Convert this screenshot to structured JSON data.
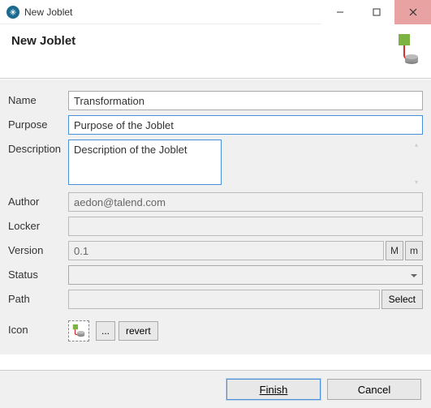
{
  "window": {
    "title": "New Joblet",
    "minimize_tip": "Minimize",
    "maximize_tip": "Maximize",
    "close_tip": "Close"
  },
  "header": {
    "title": "New Joblet"
  },
  "form": {
    "labels": {
      "name": "Name",
      "purpose": "Purpose",
      "description": "Description",
      "author": "Author",
      "locker": "Locker",
      "version": "Version",
      "status": "Status",
      "path": "Path",
      "icon": "Icon"
    },
    "name_value": "Transformation",
    "purpose_value": "Purpose of the Joblet",
    "description_value": "Description of the Joblet",
    "author_value": "aedon@talend.com",
    "locker_value": "",
    "version_value": "0.1",
    "version_major_btn": "M",
    "version_minor_btn": "m",
    "status_value": "",
    "path_value": "",
    "path_select_btn": "Select",
    "icon_browse_btn": "...",
    "icon_revert_btn": "revert"
  },
  "buttons": {
    "finish": "Finish",
    "cancel": "Cancel"
  }
}
